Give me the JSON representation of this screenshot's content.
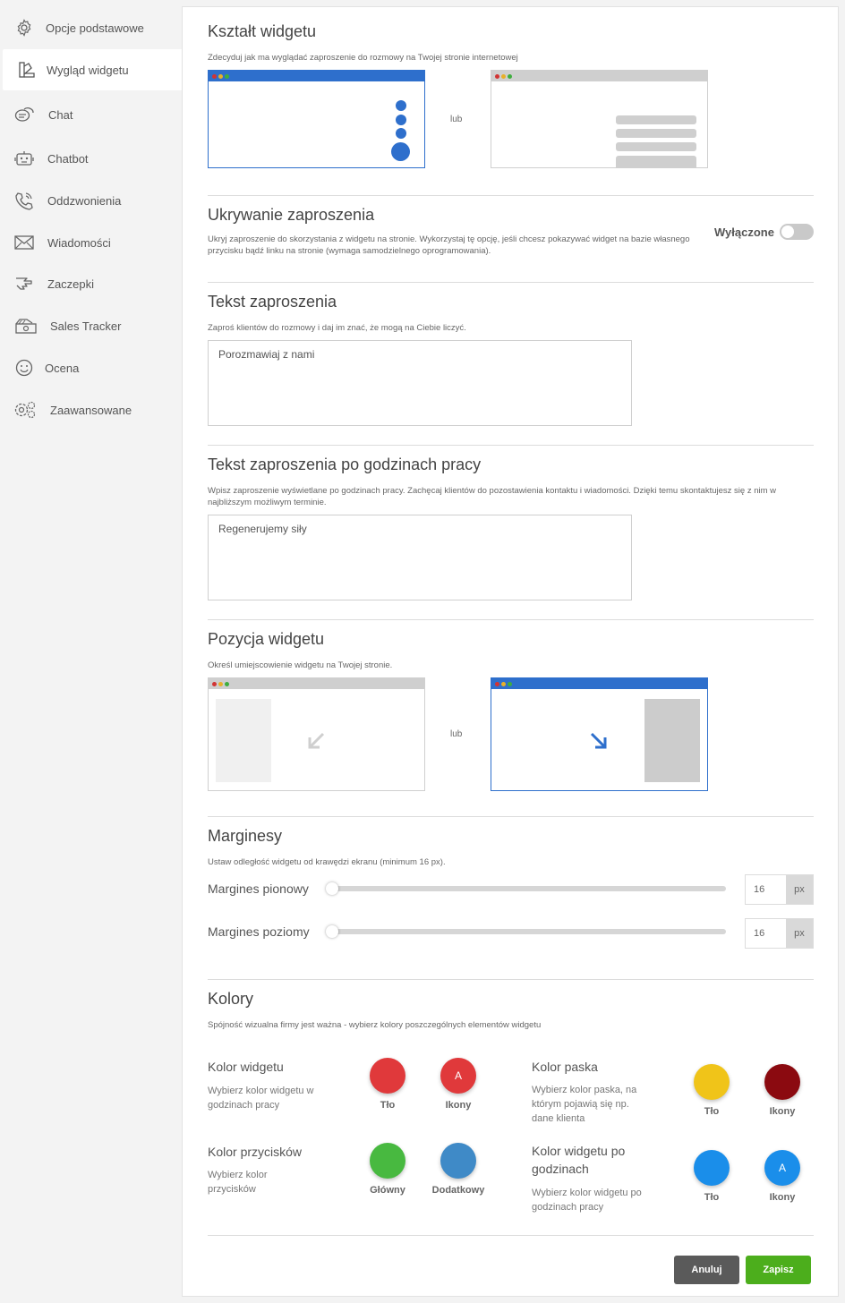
{
  "sidebar": {
    "items": [
      {
        "label": "Opcje podstawowe",
        "icon": "gear-icon"
      },
      {
        "label": "Wygląd widgetu",
        "icon": "palette-icon",
        "active": true
      },
      {
        "label": "Chat",
        "icon": "chat-bubbles-icon"
      },
      {
        "label": "Chatbot",
        "icon": "robot-icon"
      },
      {
        "label": "Oddzwonienia",
        "icon": "phone-icon"
      },
      {
        "label": "Wiadomości",
        "icon": "envelope-icon"
      },
      {
        "label": "Zaczepki",
        "icon": "hand-icon"
      },
      {
        "label": "Sales Tracker",
        "icon": "money-icon"
      },
      {
        "label": "Ocena",
        "icon": "smiley-icon"
      },
      {
        "label": "Zaawansowane",
        "icon": "gears-icon"
      }
    ]
  },
  "shape": {
    "title": "Kształt widgetu",
    "desc": "Zdecyduj jak ma wyglądać zaproszenie do rozmowy na Twojej stronie internetowej",
    "or": "lub",
    "selected": "dots"
  },
  "hiding": {
    "title": "Ukrywanie zaproszenia",
    "desc": "Ukryj zaproszenie do skorzystania z widgetu na stronie. Wykorzystaj tę opcję, jeśli chcesz pokazywać widget na bazie własnego przycisku bądź linku na stronie (wymaga samodzielnego oprogramowania).",
    "toggle_label": "Wyłączone",
    "enabled": false
  },
  "invite": {
    "title": "Tekst zaproszenia",
    "desc": "Zaproś klientów do rozmowy i daj im znać, że mogą na Ciebie liczyć.",
    "value": "Porozmawiaj z nami"
  },
  "after_hours": {
    "title": "Tekst zaproszenia po godzinach pracy",
    "desc": "Wpisz zaproszenie wyświetlane po godzinach pracy. Zachęcaj klientów do pozostawienia kontaktu i wiadomości. Dzięki temu skontaktujesz się z nim w najbliższym możliwym terminie.",
    "value": "Regenerujemy siły"
  },
  "position": {
    "title": "Pozycja widgetu",
    "desc": "Określ umiejscowienie widgetu na Twojej stronie.",
    "or": "lub",
    "selected": "right"
  },
  "margins": {
    "title": "Marginesy",
    "desc": "Ustaw odległość widgetu od krawędzi ekranu (minimum 16 px).",
    "vertical": {
      "label": "Margines pionowy",
      "value": "16",
      "unit": "px"
    },
    "horizontal": {
      "label": "Margines poziomy",
      "value": "16",
      "unit": "px"
    }
  },
  "colors": {
    "title": "Kolory",
    "desc": "Spójność wizualna firmy jest ważna - wybierz kolory poszczególnych elementów widgetu",
    "widget": {
      "title": "Kolor widgetu",
      "desc": "Wybierz kolor widgetu w godzinach pracy",
      "bg_label": "Tło",
      "icons_label": "Ikony",
      "bg": "#e0393b",
      "icons": "#e0393b",
      "icon_glyph": "A"
    },
    "bar": {
      "title": "Kolor paska",
      "desc": "Wybierz kolor paska, na którym pojawią się np. dane klienta",
      "bg_label": "Tło",
      "icons_label": "Ikony",
      "bg": "#f0c419",
      "icons": "#8b0a10"
    },
    "buttons": {
      "title": "Kolor przycisków",
      "desc": "Wybierz kolor przycisków",
      "main_label": "Główny",
      "extra_label": "Dodatkowy",
      "main": "#48b940",
      "extra": "#3f8ac7"
    },
    "after": {
      "title": "Kolor widgetu po godzinach",
      "desc": "Wybierz kolor widgetu po godzinach pracy",
      "bg_label": "Tło",
      "icons_label": "Ikony",
      "bg": "#1a8eea",
      "icons": "#1a8eea",
      "icon_glyph": "A"
    }
  },
  "actions": {
    "cancel": "Anuluj",
    "save": "Zapisz"
  }
}
